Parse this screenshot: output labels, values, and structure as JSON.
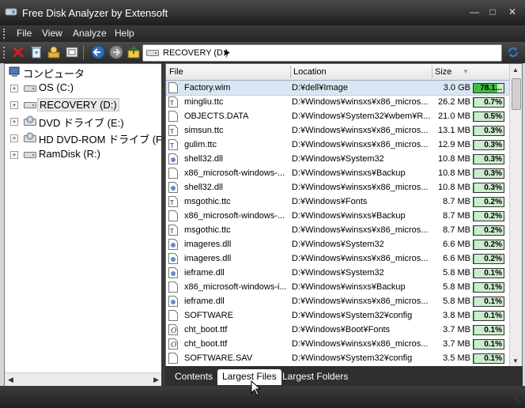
{
  "window": {
    "title": "Free Disk Analyzer by Extensoft"
  },
  "menu": [
    "File",
    "View",
    "Analyze",
    "Help"
  ],
  "toolbar": {
    "buttons": [
      "delete-icon",
      "recycle-icon",
      "properties-icon",
      "open-folder-icon",
      "back-icon",
      "forward-icon",
      "up-icon",
      "refresh-icon"
    ],
    "address": "RECOVERY (D:)"
  },
  "tree": {
    "root": "コンピュータ",
    "drives": [
      {
        "label": "OS (C:)",
        "icon": "drive-icon"
      },
      {
        "label": "RECOVERY (D:)",
        "icon": "drive-icon"
      },
      {
        "label": "DVD ドライブ (E:)",
        "icon": "dvd-icon"
      },
      {
        "label": "HD DVD-ROM ドライブ (F:)",
        "icon": "dvd-icon"
      },
      {
        "label": "RamDisk (R:)",
        "icon": "drive-icon"
      }
    ]
  },
  "list": {
    "columns": [
      "File",
      "Location",
      "Size"
    ],
    "rows": [
      {
        "name": "Factory.wim",
        "location": "D:¥dell¥Image",
        "size": "3.0 GB",
        "pct": "78.1...",
        "pct_value": 78.1,
        "icon": "file-icon"
      },
      {
        "name": "mingliu.ttc",
        "location": "D:¥Windows¥winsxs¥x86_micros...",
        "size": "26.2 MB",
        "pct": "0.7%",
        "pct_value": 0.7,
        "icon": "font-icon"
      },
      {
        "name": "OBJECTS.DATA",
        "location": "D:¥Windows¥System32¥wbem¥R...",
        "size": "21.0 MB",
        "pct": "0.5%",
        "pct_value": 0.5,
        "icon": "file-icon"
      },
      {
        "name": "simsun.ttc",
        "location": "D:¥Windows¥winsxs¥x86_micros...",
        "size": "13.1 MB",
        "pct": "0.3%",
        "pct_value": 0.3,
        "icon": "font-icon"
      },
      {
        "name": "gulim.ttc",
        "location": "D:¥Windows¥winsxs¥x86_micros...",
        "size": "12.9 MB",
        "pct": "0.3%",
        "pct_value": 0.3,
        "icon": "font-icon"
      },
      {
        "name": "shell32.dll",
        "location": "D:¥Windows¥System32",
        "size": "10.8 MB",
        "pct": "0.3%",
        "pct_value": 0.3,
        "icon": "dll-icon"
      },
      {
        "name": "x86_microsoft-windows-...",
        "location": "D:¥Windows¥winsxs¥Backup",
        "size": "10.8 MB",
        "pct": "0.3%",
        "pct_value": 0.3,
        "icon": "file-icon"
      },
      {
        "name": "shell32.dll",
        "location": "D:¥Windows¥winsxs¥x86_micros...",
        "size": "10.8 MB",
        "pct": "0.3%",
        "pct_value": 0.3,
        "icon": "dll-icon"
      },
      {
        "name": "msgothic.ttc",
        "location": "D:¥Windows¥Fonts",
        "size": "8.7 MB",
        "pct": "0.2%",
        "pct_value": 0.2,
        "icon": "font-icon"
      },
      {
        "name": "x86_microsoft-windows-...",
        "location": "D:¥Windows¥winsxs¥Backup",
        "size": "8.7 MB",
        "pct": "0.2%",
        "pct_value": 0.2,
        "icon": "file-icon"
      },
      {
        "name": "msgothic.ttc",
        "location": "D:¥Windows¥winsxs¥x86_micros...",
        "size": "8.7 MB",
        "pct": "0.2%",
        "pct_value": 0.2,
        "icon": "font-icon"
      },
      {
        "name": "imageres.dll",
        "location": "D:¥Windows¥System32",
        "size": "6.6 MB",
        "pct": "0.2%",
        "pct_value": 0.2,
        "icon": "dll-icon"
      },
      {
        "name": "imageres.dll",
        "location": "D:¥Windows¥winsxs¥x86_micros...",
        "size": "6.6 MB",
        "pct": "0.2%",
        "pct_value": 0.2,
        "icon": "dll-icon"
      },
      {
        "name": "ieframe.dll",
        "location": "D:¥Windows¥System32",
        "size": "5.8 MB",
        "pct": "0.1%",
        "pct_value": 0.1,
        "icon": "dll-icon"
      },
      {
        "name": "x86_microsoft-windows-i...",
        "location": "D:¥Windows¥winsxs¥Backup",
        "size": "5.8 MB",
        "pct": "0.1%",
        "pct_value": 0.1,
        "icon": "file-icon"
      },
      {
        "name": "ieframe.dll",
        "location": "D:¥Windows¥winsxs¥x86_micros...",
        "size": "5.8 MB",
        "pct": "0.1%",
        "pct_value": 0.1,
        "icon": "dll-icon"
      },
      {
        "name": "SOFTWARE",
        "location": "D:¥Windows¥System32¥config",
        "size": "3.8 MB",
        "pct": "0.1%",
        "pct_value": 0.1,
        "icon": "file-icon"
      },
      {
        "name": "cht_boot.ttf",
        "location": "D:¥Windows¥Boot¥Fonts",
        "size": "3.7 MB",
        "pct": "0.1%",
        "pct_value": 0.1,
        "icon": "ttf-icon"
      },
      {
        "name": "cht_boot.ttf",
        "location": "D:¥Windows¥winsxs¥x86_micros...",
        "size": "3.7 MB",
        "pct": "0.1%",
        "pct_value": 0.1,
        "icon": "ttf-icon"
      },
      {
        "name": "SOFTWARE.SAV",
        "location": "D:¥Windows¥System32¥config",
        "size": "3.5 MB",
        "pct": "0.1%",
        "pct_value": 0.1,
        "icon": "file-icon"
      }
    ]
  },
  "tabs": [
    "Contents",
    "Largest Files",
    "Largest Folders"
  ],
  "active_tab": "Largest Files",
  "colors": {
    "bar_fill": "#3fbf3f",
    "bar_bg": "#cdebcd",
    "selection": "#dbe6f3"
  }
}
